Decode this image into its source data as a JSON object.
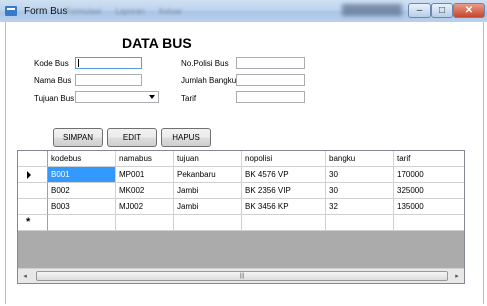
{
  "window": {
    "title": "Form Bus",
    "menu_items": [
      "Formulasi",
      "Laporan",
      "Keluar"
    ],
    "controls": {
      "minimize": "–",
      "maximize": "□",
      "close": "✕"
    }
  },
  "heading": "DATA BUS",
  "form": {
    "kode_bus": {
      "label": "Kode Bus",
      "value": ""
    },
    "nama_bus": {
      "label": "Nama Bus",
      "value": ""
    },
    "tujuan_bus": {
      "label": "Tujuan Bus",
      "value": ""
    },
    "no_polisi_bus": {
      "label": "No.Polisi Bus",
      "value": ""
    },
    "jumlah_bangku": {
      "label": "Jumlah Bangku",
      "value": ""
    },
    "tarif": {
      "label": "Tarif",
      "value": ""
    }
  },
  "buttons": {
    "simpan": "SIMPAN",
    "edit": "EDIT",
    "hapus": "HAPUS"
  },
  "grid": {
    "columns": [
      "kodebus",
      "namabus",
      "tujuan",
      "nopolisi",
      "bangku",
      "tarif"
    ],
    "rows": [
      [
        "B001",
        "MP001",
        "Pekanbaru",
        "BK 4576 VP",
        "30",
        "170000"
      ],
      [
        "B002",
        "MK002",
        "Jambi",
        "BK 2356 VIP",
        "30",
        "325000"
      ],
      [
        "B003",
        "MJ002",
        "Jambi",
        "BK 3456 KP",
        "32",
        "135000"
      ]
    ],
    "new_row_marker": "*",
    "scroll": {
      "left": "◂",
      "right": "▸",
      "grip": "|||"
    }
  },
  "colors": {
    "selection": "#3399ff",
    "grid_background": "#ababab",
    "titlebar": "#bdd3ec"
  }
}
